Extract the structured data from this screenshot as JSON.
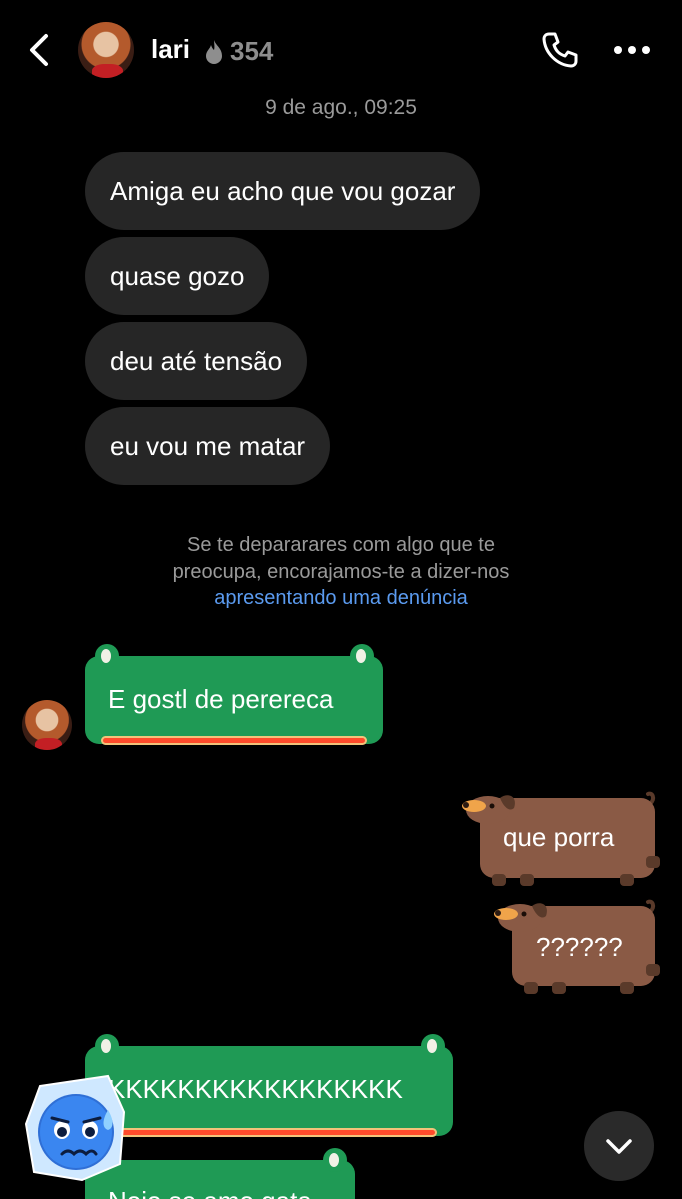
{
  "header": {
    "back_icon": "chevron-left-icon",
    "name": "lari",
    "streak_icon": "flame-icon",
    "streak_count": "354",
    "call_icon": "phone-icon",
    "more_icon": "more-horizontal-icon"
  },
  "timestamp": "9 de ago., 09:25",
  "incoming_messages": [
    "Amiga eu acho que vou gozar",
    "quase gozo",
    "deu até tensão",
    "eu vou me matar"
  ],
  "notice": {
    "text": "Se te depararares com algo que te preocupa, encorajamos-te a dizer-nos",
    "line1": "Se te depararares com algo que te",
    "line2": "preocupa, encorajamos-te a dizer-nos",
    "link": "apresentando uma denúncia"
  },
  "themed_incoming": [
    "E gostl de perereca",
    "KKKKKKKKKKKKKKKKK",
    "Nojo se amo gata"
  ],
  "outgoing_messages": [
    "que porra",
    "??????"
  ],
  "scroll_down_icon": "chevron-down-icon",
  "colors": {
    "background": "#000000",
    "bubble_incoming": "#262626",
    "themed_bubble": "#1f9a55",
    "themed_underline": "#ff4b2b",
    "dog_bubble": "#8a5a45",
    "link": "#5b9bf0",
    "muted_text": "#9a9a9a"
  }
}
